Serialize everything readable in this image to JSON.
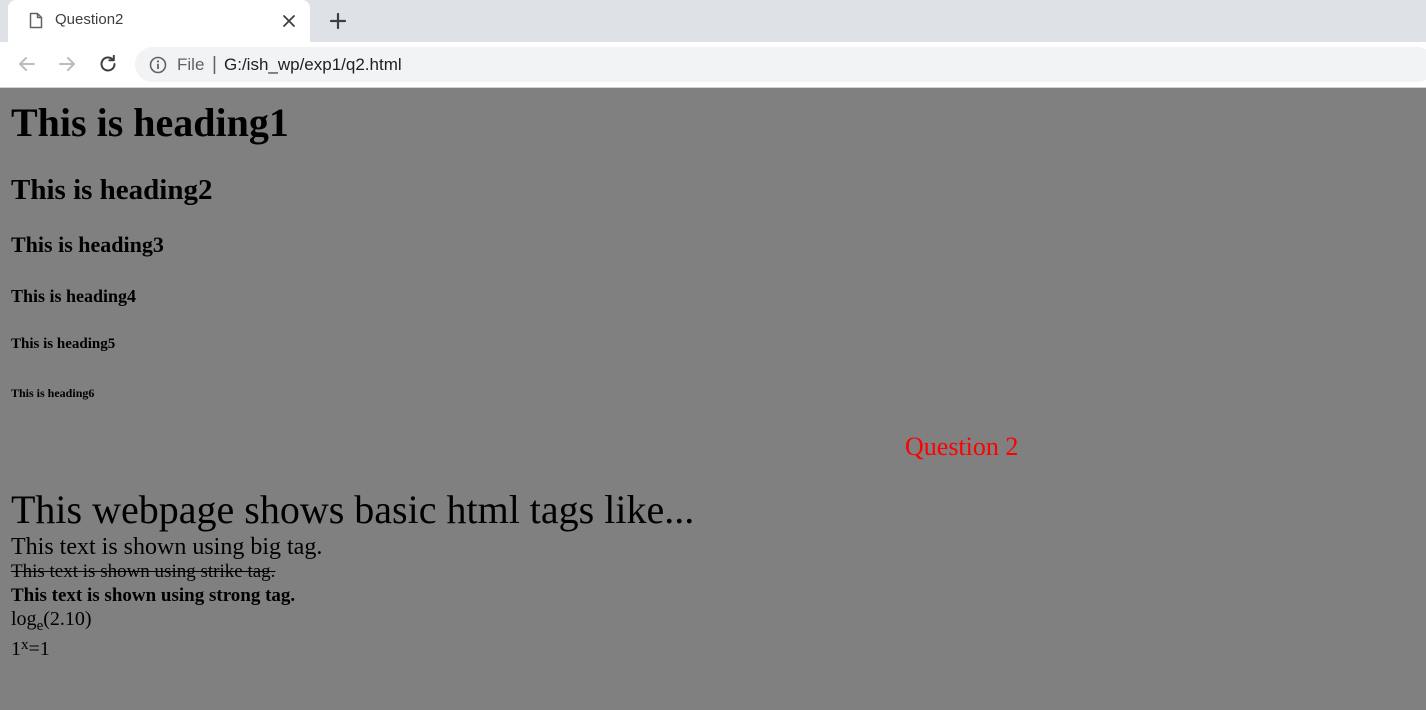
{
  "browser": {
    "tab": {
      "title": "Question2",
      "icon": "document-icon",
      "close_icon": "close-icon"
    },
    "new_tab_icon": "plus-icon",
    "toolbar": {
      "back_icon": "arrow-left-icon",
      "forward_icon": "arrow-right-icon",
      "reload_icon": "reload-icon"
    },
    "omnibox": {
      "info_icon": "info-icon",
      "scheme": "File",
      "separator": "|",
      "url": "G:/ish_wp/exp1/q2.html"
    }
  },
  "page": {
    "background": "#808080",
    "headings": [
      "This is heading1",
      "This is heading2",
      "This is heading3",
      "This is heading4",
      "This is heading5",
      "This is heading6"
    ],
    "question_label": "Question 2",
    "question_color": "#ff0000",
    "intro": "This webpage shows basic html tags like...",
    "big_text": "This text is shown using big tag.",
    "strike_text": "This text is shown using strike tag.",
    "strong_text": "This text is shown using strong tag.",
    "log_expr": {
      "base": "log",
      "subscript": "e",
      "argument": "(2.10)"
    },
    "power_expr": {
      "base": "1",
      "superscript": "x",
      "rest": "=1"
    }
  }
}
